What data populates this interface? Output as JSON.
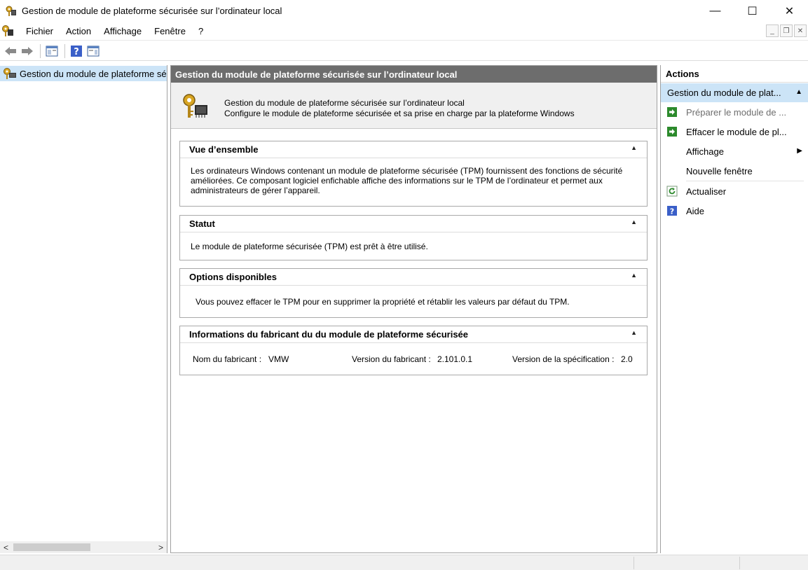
{
  "window": {
    "title": "Gestion de module de plateforme sécurisée sur l’ordinateur local",
    "minimize": "—",
    "maximize": "☐",
    "close": "✕"
  },
  "menu": {
    "items": [
      "Fichier",
      "Action",
      "Affichage",
      "Fenêtre",
      "?"
    ]
  },
  "mdi": {
    "minimize": "_",
    "restore": "❐",
    "close": "✕"
  },
  "toolbar": {
    "icons": [
      "back-arrow-icon",
      "forward-arrow-icon",
      "show-hide-console-tree-icon",
      "help-icon",
      "show-hide-action-pane-icon"
    ]
  },
  "tree": {
    "root_label": "Gestion du module de plateforme sécurisée sur l’ordinateur local",
    "scroll_left": "<",
    "scroll_right": ">"
  },
  "center": {
    "header": "Gestion du module de plateforme sécurisée sur l’ordinateur local",
    "intro_line1": "Gestion du module de plateforme sécurisée sur l’ordinateur local",
    "intro_line2": "Configure le module de plateforme sécurisée et sa prise en charge par la plateforme Windows",
    "sections": {
      "overview": {
        "title": "Vue d’ensemble",
        "text": "Les ordinateurs Windows contenant un module de plateforme sécurisée (TPM) fournissent des fonctions de sécurité améliorées. Ce composant logiciel enfichable affiche des informations sur le TPM de l’ordinateur et permet aux administrateurs de gérer l’appareil."
      },
      "status": {
        "title": "Statut",
        "text": "Le module de plateforme sécurisée (TPM) est prêt à être utilisé."
      },
      "options": {
        "title": "Options disponibles",
        "text": "Vous pouvez effacer le TPM pour en supprimer la propriété et rétablir les valeurs par défaut du TPM."
      },
      "manufacturer": {
        "title": "Informations du fabricant du du module de plateforme sécurisée",
        "name_label": "Nom du fabricant :",
        "name_value": "VMW",
        "version_label": "Version du fabricant :",
        "version_value": "2.101.0.1",
        "spec_label": "Version de la spécification :",
        "spec_value": "2.0"
      },
      "toggle": "▲"
    }
  },
  "actions": {
    "title": "Actions",
    "group": "Gestion du module de plat...",
    "items": {
      "prepare": "Préparer le module de ...",
      "clear": "Effacer le module de pl...",
      "view": "Affichage",
      "new_window": "Nouvelle fenêtre",
      "refresh": "Actualiser",
      "help": "Aide"
    },
    "caret": "▲",
    "submenu_arrow": "▶"
  },
  "colors": {
    "header_bg": "#6d6d6d",
    "selection_bg": "#cce4f7",
    "action_green": "#2c8a2c",
    "help_blue": "#3a5fc8"
  }
}
